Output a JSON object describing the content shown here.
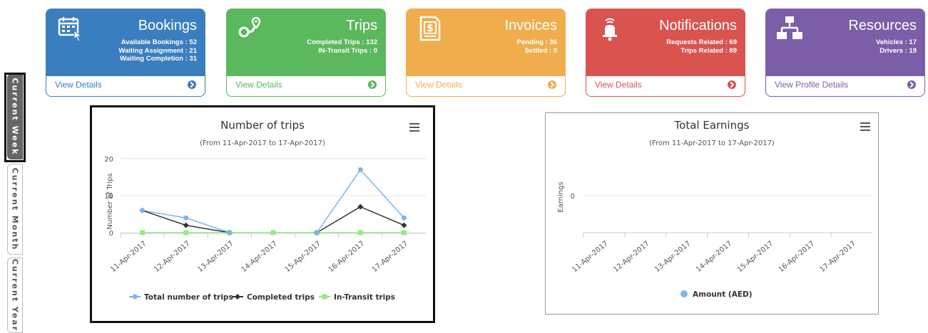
{
  "tabs": [
    {
      "label": "Current Week",
      "active": true
    },
    {
      "label": "Current Month",
      "active": false
    },
    {
      "label": "Current Year",
      "active": false
    }
  ],
  "cards": [
    {
      "title": "Bookings",
      "icon": "calendar-cursor-icon",
      "color": "#3a7ebf",
      "lines": [
        "Available Bookings : 52",
        "Waiting Assignment : 21",
        "Waiting Completion : 31"
      ],
      "link": "View Details"
    },
    {
      "title": "Trips",
      "icon": "route-pin-icon",
      "color": "#5cb85c",
      "lines": [
        "Completed Trips : 132",
        "IN-Transit Trips : 0"
      ],
      "link": "View Details"
    },
    {
      "title": "Invoices",
      "icon": "invoice-dollar-icon",
      "color": "#f0ad4e",
      "lines": [
        "Pending : 36",
        "Settled : 0"
      ],
      "link": "View Details"
    },
    {
      "title": "Notifications",
      "icon": "bell-signal-icon",
      "color": "#d9534f",
      "lines": [
        "Requests Related : 69",
        "Trips Related : 89"
      ],
      "link": "View Details"
    },
    {
      "title": "Resources",
      "icon": "hierarchy-icon",
      "color": "#7b5ea7",
      "lines": [
        "Vehicles : 17",
        "Drivers : 19"
      ],
      "link": "View Profile Details"
    }
  ],
  "chart_data": [
    {
      "type": "line",
      "title": "Number of trips",
      "subtitle": "(From 11-Apr-2017 to 17-Apr-2017)",
      "ylabel": "Number of Trips",
      "ylim": [
        0,
        20
      ],
      "yticks": [
        "0",
        "10",
        "20"
      ],
      "grid": true,
      "legend": "bottom",
      "categories": [
        "11-Apr-2017",
        "12-Apr-2017",
        "13-Apr-2017",
        "14-Apr-2017",
        "15-Apr-2017",
        "16-Apr-2017",
        "17-Apr-2017"
      ],
      "series": [
        {
          "name": "Total number of trips",
          "color": "#7cb5ec",
          "marker": "circle",
          "values": [
            6,
            4,
            0,
            null,
            0,
            17,
            4
          ]
        },
        {
          "name": "Completed trips",
          "color": "#333333",
          "marker": "diamond",
          "values": [
            6,
            2,
            0,
            null,
            0,
            7,
            2
          ]
        },
        {
          "name": "In-Transit trips",
          "color": "#90ed7d",
          "marker": "square",
          "values": [
            0,
            0,
            0,
            0,
            0,
            0,
            0
          ]
        }
      ]
    },
    {
      "type": "line",
      "title": "Total Earnings",
      "subtitle": "(From 11-Apr-2017 to 17-Apr-2017)",
      "ylabel": "Earnings",
      "yticks": [
        "0"
      ],
      "grid": true,
      "legend": "bottom",
      "categories": [
        "11-Apr-2017",
        "12-Apr-2017",
        "13-Apr-2017",
        "14-Apr-2017",
        "15-Apr-2017",
        "16-Apr-2017",
        "17-Apr-2017"
      ],
      "series": [
        {
          "name": "Amount (AED)",
          "color": "#7cb5ec",
          "marker": "circle",
          "values": []
        }
      ]
    }
  ]
}
